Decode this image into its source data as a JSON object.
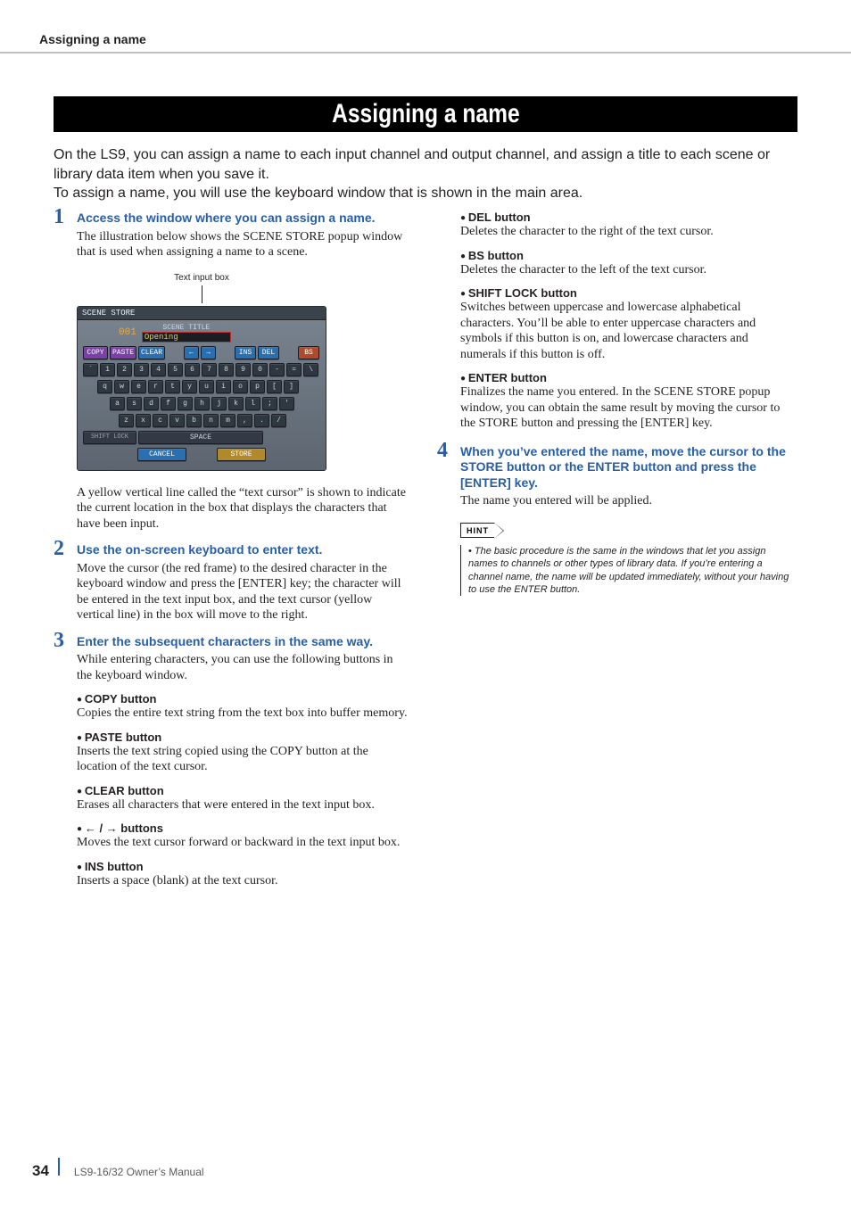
{
  "header": {
    "title": "Assigning a name"
  },
  "banner": {
    "title": "Assigning a name"
  },
  "intro": {
    "p1": "On the LS9, you can assign a name to each input channel and output channel, and assign a title to each scene or library data item when you save it.",
    "p2": "To assign a name, you will use the keyboard window that is shown in the main area."
  },
  "steps": {
    "s1": {
      "num": "1",
      "title": "Access the window where you can assign a name.",
      "body": "The illustration below shows the SCENE STORE popup window that is used when assigning a name to a scene.",
      "after": "A yellow vertical line called the “text cursor” is shown to indicate the current location in the box that displays the characters that have been input."
    },
    "s2": {
      "num": "2",
      "title": "Use the on-screen keyboard to enter text.",
      "body": "Move the cursor (the red frame) to the desired character in the keyboard window and press the [ENTER] key; the character will be entered in the text input box, and the text cursor (yellow vertical line) in the box will move to the right."
    },
    "s3": {
      "num": "3",
      "title": "Enter the subsequent characters in the same way.",
      "body": "While entering characters, you can use the following buttons in the keyboard window."
    },
    "s4": {
      "num": "4",
      "title": "When you’ve entered the name, move the cursor to the STORE button or the ENTER button and press the [ENTER] key.",
      "body": "The name you entered will be applied."
    }
  },
  "subsections": {
    "copy": {
      "head": "COPY button",
      "body": "Copies the entire text string from the text box into buffer memory."
    },
    "paste": {
      "head": "PASTE button",
      "body": "Inserts the text string copied using the COPY button at the location of the text cursor."
    },
    "clear": {
      "head": "CLEAR button",
      "body": "Erases all characters that were entered in the text input box."
    },
    "arrows": {
      "head": "← / → buttons",
      "body": "Moves the text cursor forward or backward in the text input box."
    },
    "ins": {
      "head": "INS button",
      "body": "Inserts a space (blank) at the text cursor."
    },
    "del": {
      "head": "DEL button",
      "body": "Deletes the character to the right of the text cursor."
    },
    "bs": {
      "head": "BS button",
      "body": "Deletes the character to the left of the text cursor."
    },
    "shift": {
      "head": "SHIFT LOCK button",
      "body": "Switches between uppercase and lowercase alphabetical characters. You’ll be able to enter uppercase characters and symbols if this button is on, and lowercase characters and numerals if this button is off."
    },
    "enter": {
      "head": "ENTER button",
      "body": "Finalizes the name you entered. In the SCENE STORE popup window, you can obtain the same result by moving the cursor to the STORE button and pressing the [ENTER] key."
    }
  },
  "hint": {
    "label": "HINT",
    "text": "The basic procedure is the same in the windows that let you assign names to channels or other types of library data. If you’re entering a channel name, the name will be updated immediately, without your having to use the ENTER button."
  },
  "figure": {
    "label": "Text input box",
    "popup_title": "SCENE STORE",
    "scene_title_label": "SCENE TITLE",
    "scene_number": "001",
    "text_value": "Opening",
    "keys": {
      "copy": "COPY",
      "paste": "PASTE",
      "clear": "CLEAR",
      "left": "←",
      "right": "→",
      "ins": "INS",
      "del": "DEL",
      "bs": "BS",
      "shift": "SHIFT LOCK",
      "space": "SPACE",
      "cancel": "CANCEL",
      "store": "STORE",
      "row1": [
        "`",
        "1",
        "2",
        "3",
        "4",
        "5",
        "6",
        "7",
        "8",
        "9",
        "0",
        "-",
        "=",
        "\\"
      ],
      "row2": [
        "q",
        "w",
        "e",
        "r",
        "t",
        "y",
        "u",
        "i",
        "o",
        "p",
        "[",
        "]"
      ],
      "row3": [
        "a",
        "s",
        "d",
        "f",
        "g",
        "h",
        "j",
        "k",
        "l",
        ";",
        "'"
      ],
      "row4": [
        "z",
        "x",
        "c",
        "v",
        "b",
        "n",
        "m",
        ",",
        ".",
        "/"
      ]
    }
  },
  "footer": {
    "page": "34",
    "text": "LS9-16/32  Owner’s Manual"
  }
}
